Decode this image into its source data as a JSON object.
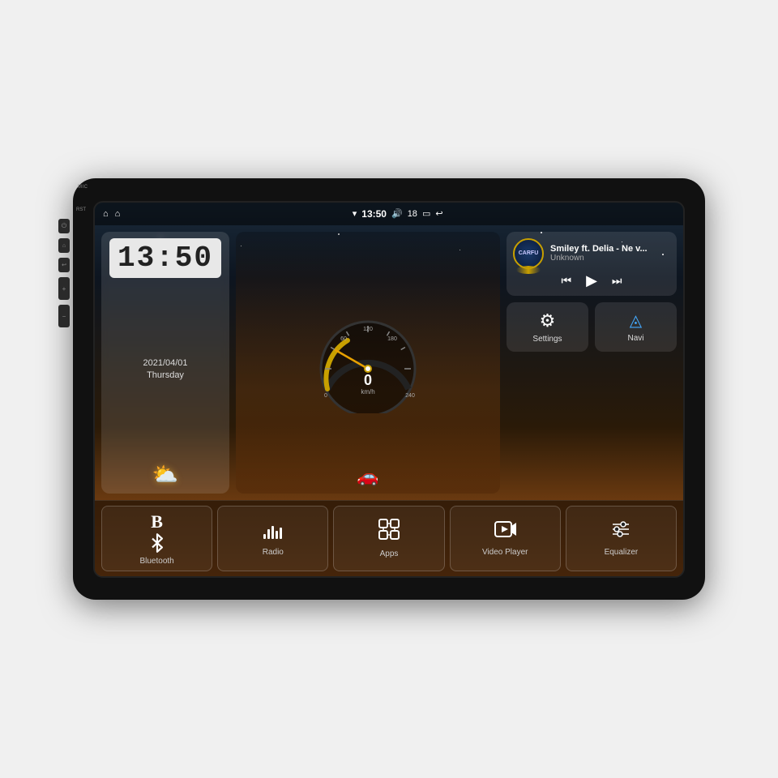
{
  "device": {
    "mic_label": "MIC",
    "rst_label": "RST"
  },
  "status_bar": {
    "left_icons": [
      "⌂",
      "⌂"
    ],
    "time": "13:50",
    "volume_icon": "🔊",
    "volume_level": "18",
    "battery_icon": "▭",
    "back_icon": "↩"
  },
  "clock_widget": {
    "time": "13:50",
    "date_line1": "2021/04/01",
    "date_line2": "Thursday",
    "weather_icon": "⛅"
  },
  "music_widget": {
    "logo_text": "CARFU",
    "title": "Smiley ft. Delia - Ne v...",
    "artist": "Unknown",
    "prev_icon": "⏮",
    "play_icon": "▶",
    "next_icon": "⏭"
  },
  "action_buttons": [
    {
      "id": "settings",
      "icon": "⚙",
      "label": "Settings"
    },
    {
      "id": "navi",
      "icon": "▲",
      "label": "Navi"
    }
  ],
  "dock_items": [
    {
      "id": "bluetooth",
      "icon": "₿",
      "label": "Bluetooth"
    },
    {
      "id": "radio",
      "icon": "📶",
      "label": "Radio"
    },
    {
      "id": "apps",
      "icon": "⊞",
      "label": "Apps"
    },
    {
      "id": "video",
      "icon": "▶",
      "label": "Video Player"
    },
    {
      "id": "equalizer",
      "icon": "≡",
      "label": "Equalizer"
    }
  ],
  "speedometer": {
    "speed": "0",
    "unit": "km/h",
    "max": "240"
  }
}
